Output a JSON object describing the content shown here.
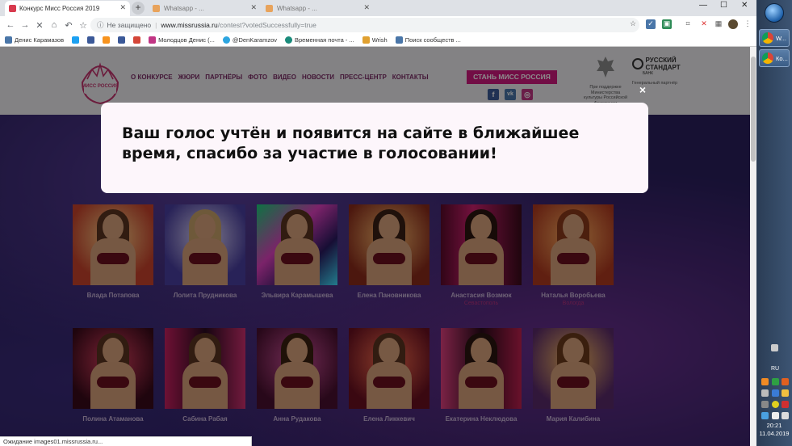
{
  "browser": {
    "active_tab_title": "Конкурс Мисс Россия 2019",
    "inactive_tab_1": "Whatsapp - ...",
    "inactive_tab_2": "Whatsapp - ...",
    "new_tab_label": "+",
    "security_label": "Не защищено",
    "url_host": "www.missrussia.ru",
    "url_path": "/contest?votedSuccessfully=true",
    "bookmarks": [
      {
        "label": "Денис Карамазов",
        "color": "#4a76a8"
      },
      {
        "label": "",
        "color": "#1da1f2"
      },
      {
        "label": "",
        "color": "#3b5998"
      },
      {
        "label": "",
        "color": "#f7931e"
      },
      {
        "label": "",
        "color": "#3b5998"
      },
      {
        "label": "",
        "color": "#d44638"
      },
      {
        "label": "Молодцов Денис (...",
        "color": "#c13584"
      },
      {
        "label": "@DenKaramzov",
        "color": "#2ca5e0"
      },
      {
        "label": "Временная почта - ...",
        "color": "#1a8b7b"
      },
      {
        "label": "Wrish",
        "color": "#e0a030"
      },
      {
        "label": "Поиск сообществ ...",
        "color": "#4a76a8"
      }
    ],
    "status_text": "Ожидание images01.missrussia.ru..."
  },
  "site": {
    "nav": [
      "О КОНКУРСЕ",
      "ЖЮРИ",
      "ПАРТНЁРЫ",
      "ФОТО",
      "ВИДЕО",
      "НОВОСТИ",
      "ПРЕСС-ЦЕНТР",
      "КОНТАКТЫ"
    ],
    "cta": "СТАНЬ МИСС РОССИЯ",
    "logo_text": "МИСС РОССИЯ",
    "partner1_text": "При поддержке Министерства культуры Российской Федерации",
    "partner2_name": "РУССКИЙ СТАНДАРТ",
    "partner2_sub": "БАНК",
    "partner2_text": "Генеральный партнёр",
    "social": [
      "f",
      "vk",
      "ig"
    ],
    "contestants": [
      {
        "name": "Влада Потапова",
        "city": ""
      },
      {
        "name": "Лолита Прудникова",
        "city": ""
      },
      {
        "name": "Эльвира Карамышева",
        "city": ""
      },
      {
        "name": "Елена Пановникова",
        "city": ""
      },
      {
        "name": "Анастасия Возмюк",
        "city": "Севастополь"
      },
      {
        "name": "Наталья Воробьева",
        "city": "Вологда"
      },
      {
        "name": "Полина Атаманова",
        "city": ""
      },
      {
        "name": "Сабина Рабая",
        "city": ""
      },
      {
        "name": "Анна Рудакова",
        "city": ""
      },
      {
        "name": "Елена Ликкевич",
        "city": ""
      },
      {
        "name": "Екатерина Неклюдова",
        "city": ""
      },
      {
        "name": "Мария Калибина",
        "city": ""
      }
    ]
  },
  "modal": {
    "message": "Ваш голос учтён и появится на сайте в ближайшее время, спасибо за участие в голосовании!",
    "close_label": "×"
  },
  "taskbar": {
    "tasks": [
      "W...",
      "Ко..."
    ],
    "language": "RU",
    "time": "20:21",
    "date": "11.04.2019"
  },
  "colors": {
    "brand_magenta": "#d0187f",
    "nav_purple": "#7a2a64",
    "modal_bg": "#fdf6fb"
  }
}
